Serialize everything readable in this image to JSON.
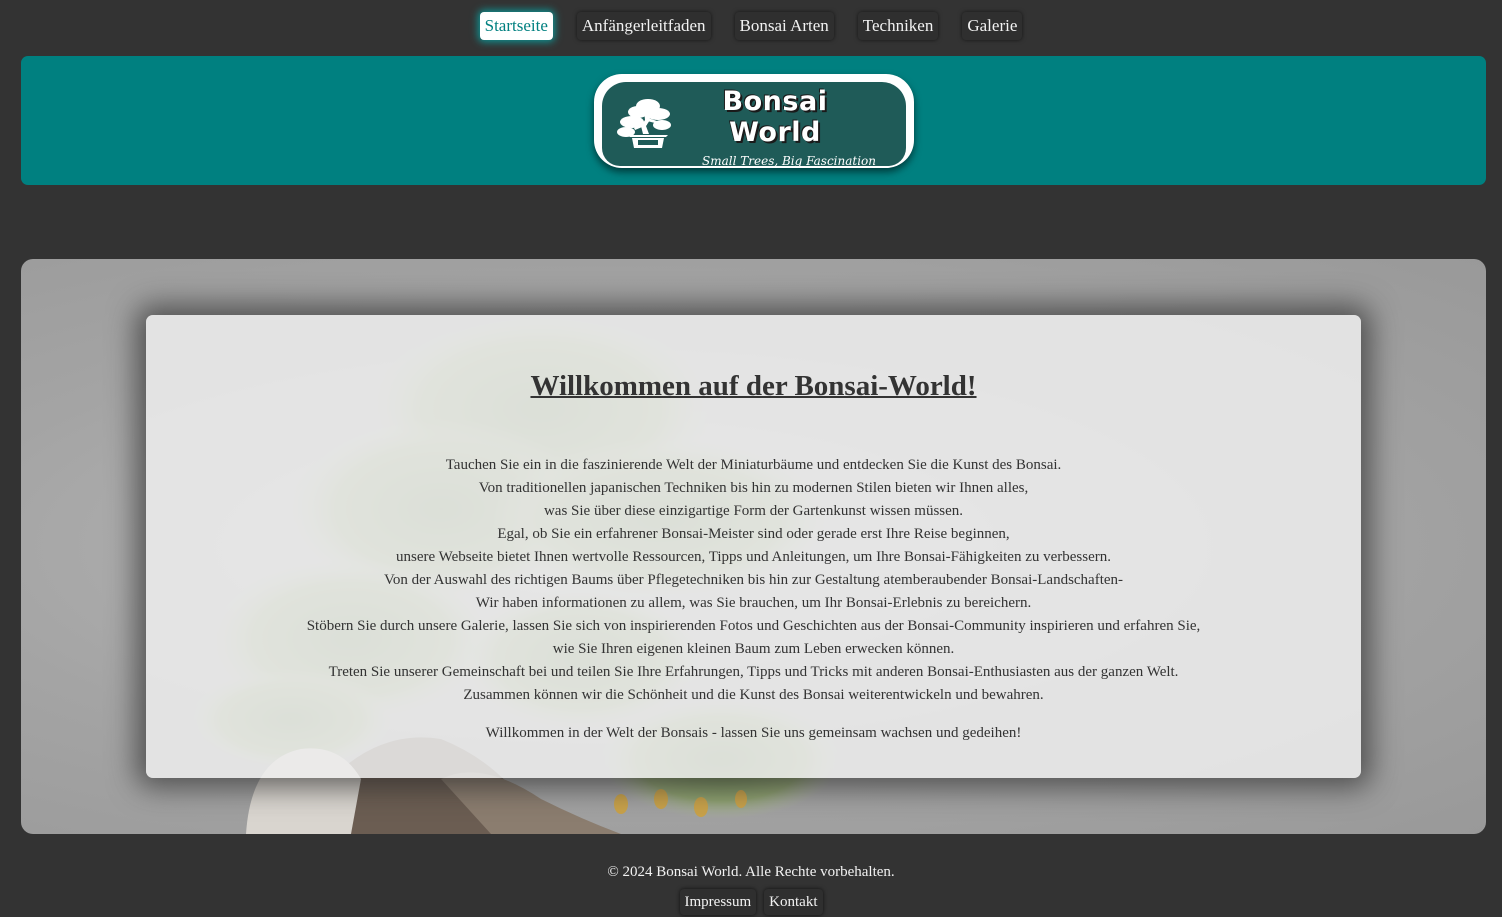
{
  "nav": {
    "items": [
      {
        "label": "Startseite",
        "active": true
      },
      {
        "label": "Anfängerleitfaden",
        "active": false
      },
      {
        "label": "Bonsai Arten",
        "active": false
      },
      {
        "label": "Techniken",
        "active": false
      },
      {
        "label": "Galerie",
        "active": false
      }
    ]
  },
  "header": {
    "logo_line1": "Bonsai",
    "logo_line2": "World",
    "tagline": "Small Trees, Big Fascination",
    "icon": "bonsai-tree-icon"
  },
  "main": {
    "title": "Willkommen auf der Bonsai-World!",
    "lines": [
      "Tauchen Sie ein in die faszinierende Welt der Miniaturbäume und entdecken Sie die Kunst des Bonsai.",
      "Von traditionellen japanischen Techniken bis hin zu modernen Stilen bieten wir Ihnen alles,",
      "was Sie über diese einzigartige Form der Gartenkunst wissen müssen.",
      "Egal, ob Sie ein erfahrener Bonsai-Meister sind oder gerade erst Ihre Reise beginnen,",
      "unsere Webseite bietet Ihnen wertvolle Ressourcen, Tipps und Anleitungen, um Ihre Bonsai-Fähigkeiten zu verbessern.",
      "Von der Auswahl des richtigen Baums über Pflegetechniken bis hin zur Gestaltung atemberaubender Bonsai-Landschaften-",
      "Wir haben informationen zu allem, was Sie brauchen, um Ihr Bonsai-Erlebnis zu bereichern.",
      "Stöbern Sie durch unsere Galerie, lassen Sie sich von inspirierenden Fotos und Geschichten aus der Bonsai-Community inspirieren und erfahren Sie,",
      "wie Sie Ihren eigenen kleinen Baum zum Leben erwecken können.",
      "Treten Sie unserer Gemeinschaft bei und teilen Sie Ihre Erfahrungen, Tipps und Tricks mit anderen Bonsai-Enthusiasten aus der ganzen Welt.",
      "Zusammen können wir die Schönheit und die Kunst des Bonsai weiterentwickeln und bewahren."
    ],
    "closing": "Willkommen in der Welt der Bonsais - lassen Sie uns gemeinsam wachsen und gedeihen!"
  },
  "footer": {
    "copyright": "© 2024 Bonsai World. Alle Rechte vorbehalten.",
    "links": [
      "Impressum",
      "Kontakt"
    ]
  },
  "colors": {
    "background": "#333333",
    "accent": "#008080",
    "logo_panel": "#1f5b58",
    "card": "#eeeeee",
    "text": "#333333"
  }
}
